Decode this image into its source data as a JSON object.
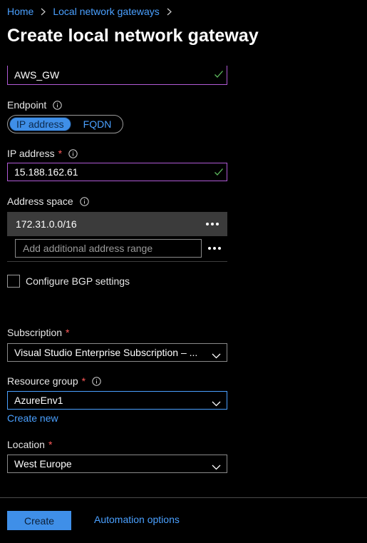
{
  "breadcrumb": {
    "home": "Home",
    "parent": "Local network gateways"
  },
  "page_title": "Create local network gateway",
  "name_field": {
    "value": "AWS_GW"
  },
  "endpoint": {
    "label": "Endpoint",
    "options": [
      "IP address",
      "FQDN"
    ],
    "selected": "IP address"
  },
  "ip_address": {
    "label": "IP address",
    "required_mark": "*",
    "value": "15.188.162.61"
  },
  "address_space": {
    "label": "Address space",
    "rows": [
      "172.31.0.0/16"
    ],
    "add_placeholder": "Add additional address range"
  },
  "bgp": {
    "label": "Configure BGP settings",
    "checked": false
  },
  "subscription": {
    "label": "Subscription",
    "required_mark": "*",
    "value": "Visual Studio Enterprise Subscription – ..."
  },
  "resource_group": {
    "label": "Resource group",
    "required_mark": "*",
    "value": "AzureEnv1",
    "create_new": "Create new"
  },
  "location": {
    "label": "Location",
    "required_mark": "*",
    "value": "West Europe"
  },
  "footer": {
    "create_label": "Create",
    "automation_label": "Automation options"
  },
  "colors": {
    "accent": "#4aa0ff",
    "primary_button": "#3f8fe8",
    "valid_border": "#b05ad6",
    "required": "#ff5a5a",
    "background": "#000000"
  },
  "icons": [
    "chevron-right-icon",
    "check-icon",
    "info-icon",
    "more-icon",
    "chevron-down-icon"
  ]
}
